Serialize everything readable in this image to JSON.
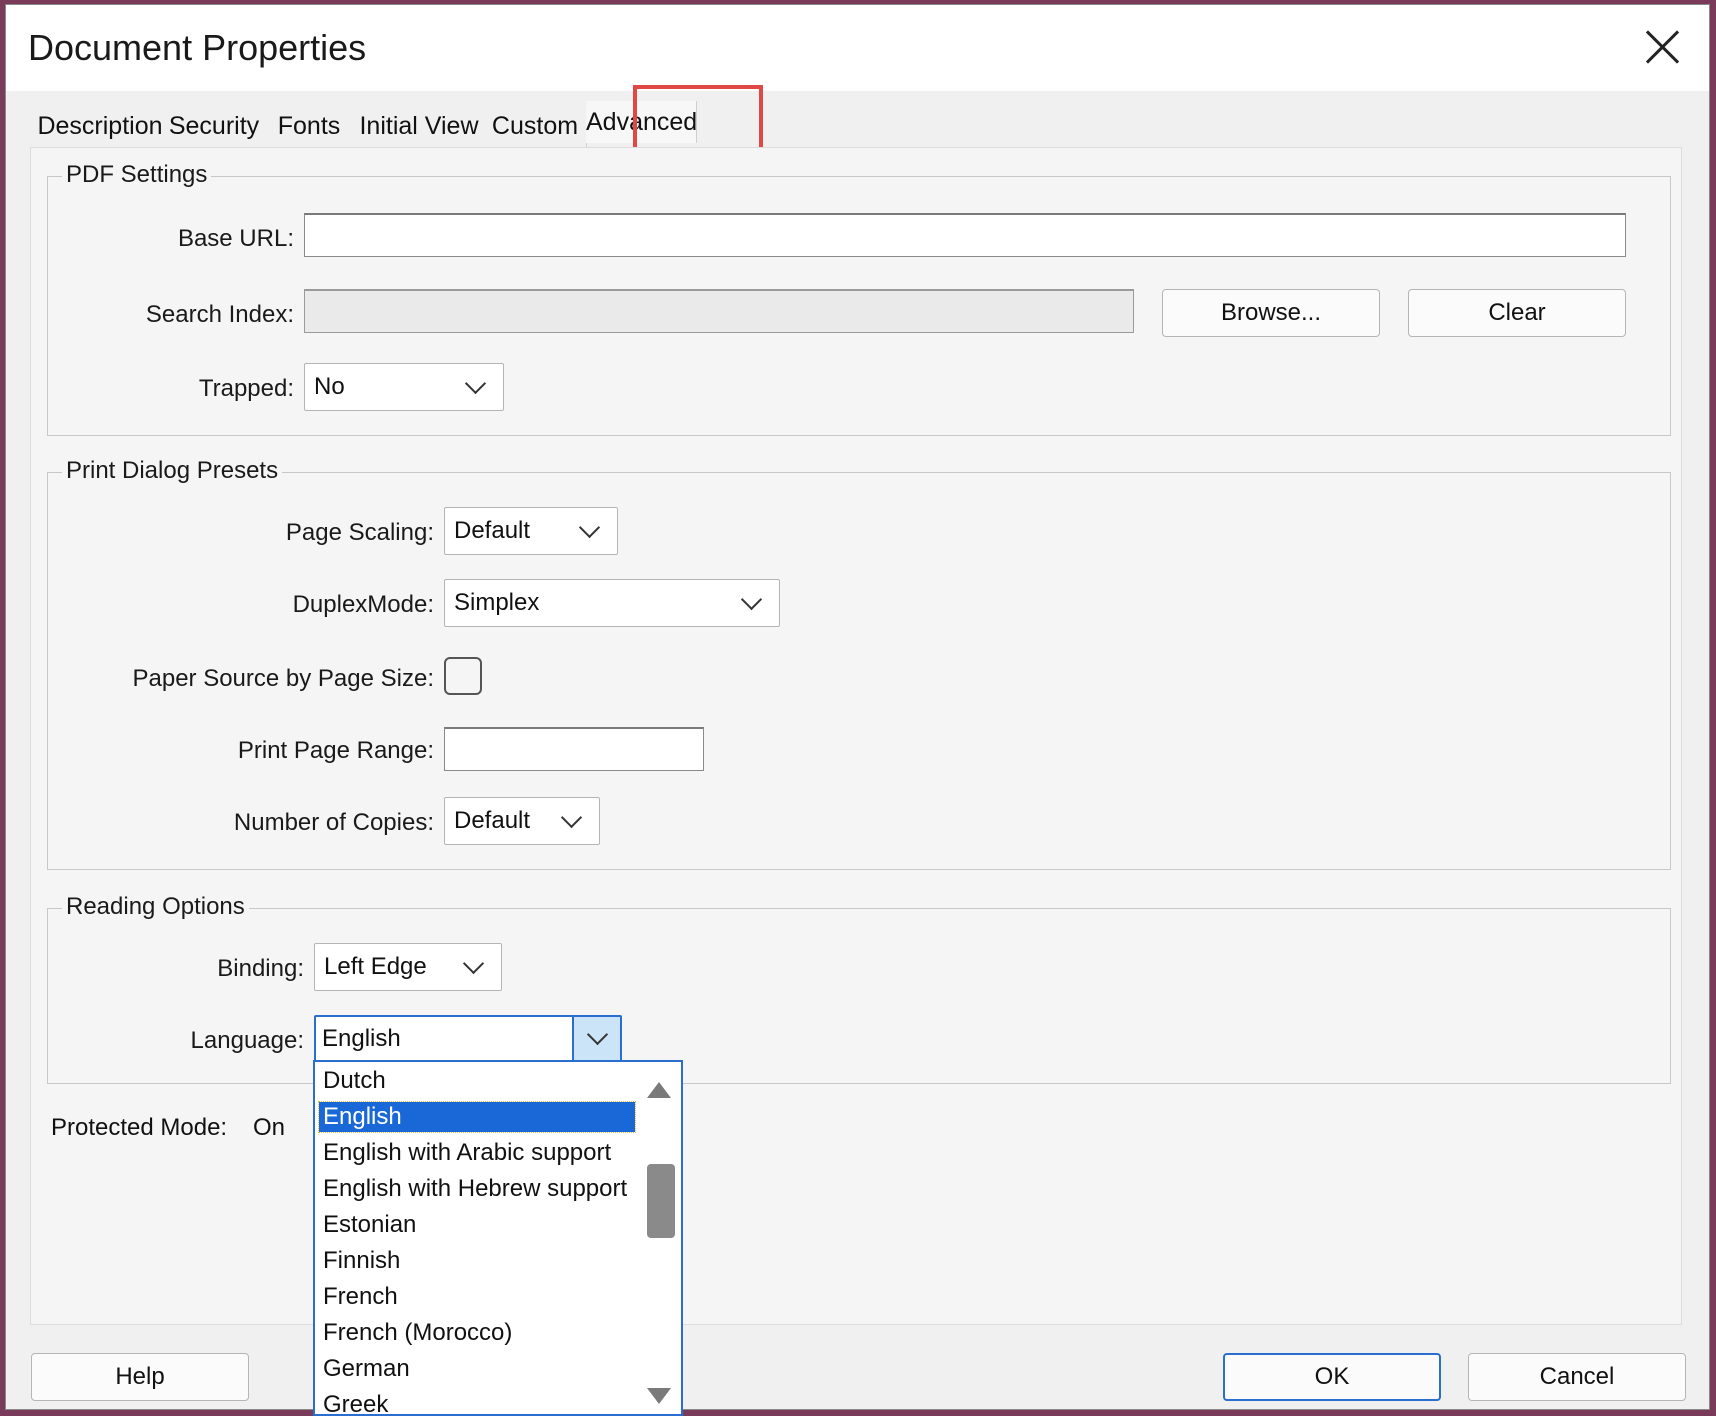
{
  "dialog": {
    "title": "Document Properties"
  },
  "tabs": [
    "Description",
    "Security",
    "Fonts",
    "Initial View",
    "Custom",
    "Advanced"
  ],
  "active_tab": "Advanced",
  "pdf_settings": {
    "legend": "PDF Settings",
    "base_url_label": "Base URL:",
    "base_url_value": "",
    "search_index_label": "Search Index:",
    "search_index_value": "",
    "browse_label": "Browse...",
    "clear_label": "Clear",
    "trapped_label": "Trapped:",
    "trapped_value": "No"
  },
  "print_presets": {
    "legend": "Print Dialog Presets",
    "page_scaling_label": "Page Scaling:",
    "page_scaling_value": "Default",
    "duplex_label": "DuplexMode:",
    "duplex_value": "Simplex",
    "paper_source_label": "Paper Source by Page Size:",
    "paper_source_checked": false,
    "print_range_label": "Print Page Range:",
    "print_range_value": "",
    "copies_label": "Number of Copies:",
    "copies_value": "Default"
  },
  "reading_options": {
    "legend": "Reading Options",
    "binding_label": "Binding:",
    "binding_value": "Left Edge",
    "language_label": "Language:",
    "language_value": "English"
  },
  "protected_mode": {
    "label": "Protected Mode:",
    "value": "On"
  },
  "language_options": [
    "Dutch",
    "English",
    "English with Arabic support",
    "English with Hebrew support",
    "Estonian",
    "Finnish",
    "French",
    "French (Morocco)",
    "German",
    "Greek"
  ],
  "language_selected": "English",
  "buttons": {
    "help": "Help",
    "ok": "OK",
    "cancel": "Cancel"
  },
  "colors": {
    "highlight_box": "#e04848",
    "selection": "#1a68d8",
    "focus": "#2a6fcf"
  }
}
